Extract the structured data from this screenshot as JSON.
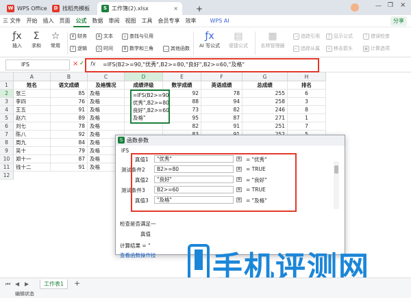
{
  "tabs": {
    "wps": "WPS Office",
    "template": "找稻壳模板",
    "file": "工作簿(2).xlsx",
    "add": "+"
  },
  "window": {
    "share": "分享"
  },
  "menus": [
    "三 文件",
    "开始",
    "插入",
    "页面",
    "公式",
    "数据",
    "审阅",
    "视图",
    "工具",
    "会员专享",
    "效率"
  ],
  "wps_ai": "WPS AI",
  "ribbon": {
    "insert_fn": "插入",
    "sum": "求和",
    "common": "常用",
    "finance": "财务",
    "logic": "逻辑",
    "text": "文本",
    "time": "时间",
    "lookup": "查找与引用",
    "math": "数学和三角",
    "other": "其他函数",
    "ai_formula": "AI 写公式",
    "convert": "便捷公式",
    "name_mgr": "名称管理器",
    "track_prec": "追踪引用",
    "track_dep": "追踪从属",
    "show_formula": "显示公式",
    "remove_arrow": "移去箭头",
    "error_check": "错误检查",
    "calc_mode": "计算工作表",
    "eval": "计算选项"
  },
  "formula_bar": {
    "name_box": "IFS",
    "fx": "fx",
    "cancel": "×",
    "confirm": "✓",
    "formula": "=IFS(B2>=90,\"优秀\",B2>=80,\"良好\",B2>=60,\"及格\""
  },
  "columns": [
    "A",
    "B",
    "C",
    "D",
    "E",
    "F",
    "G",
    "H"
  ],
  "rows": [
    "1",
    "2",
    "3",
    "4",
    "5",
    "6",
    "7",
    "8",
    "9",
    "10",
    "11",
    "12"
  ],
  "headers": [
    "姓名",
    "语文成绩",
    "及格情况",
    "成绩评级",
    "数学成绩",
    "英语成绩",
    "总成绩",
    "排名"
  ],
  "data_rows": [
    [
      "张三",
      "85",
      "及格",
      "",
      "92",
      "78",
      "255",
      "6"
    ],
    [
      "李四",
      "76",
      "及格",
      "",
      "88",
      "94",
      "258",
      "3"
    ],
    [
      "王五",
      "91",
      "及格",
      "",
      "73",
      "82",
      "246",
      "8"
    ],
    [
      "赵六",
      "89",
      "及格",
      "",
      "95",
      "87",
      "271",
      "1"
    ],
    [
      "刘七",
      "78",
      "及格",
      "",
      "82",
      "91",
      "251",
      "7"
    ],
    [
      "陈八",
      "92",
      "及格",
      "",
      "83",
      "91",
      "252",
      "5"
    ],
    [
      "周九",
      "84",
      "及格",
      "",
      "",
      "",
      "",
      ""
    ],
    [
      "吴十",
      "79",
      "及格",
      "",
      "",
      "",
      "",
      ""
    ],
    [
      "郑十一",
      "87",
      "及格",
      "",
      "",
      "",
      "",
      ""
    ],
    [
      "钱十二",
      "91",
      "及格",
      "",
      "",
      "",
      "",
      ""
    ]
  ],
  "edit_cell": "=IFS(B2>=90,\"\n优秀\",B2>=80,\"\n良好\",B2>=60,\"\n及格\"",
  "dialog": {
    "title": "函数参数",
    "fn": "IFS",
    "args": [
      {
        "label": "真值1",
        "value": "\"优秀\"",
        "result": "= \"优秀\""
      },
      {
        "label": "测试条件2",
        "value": "B2>=80",
        "result": "= TRUE"
      },
      {
        "label": "真值2",
        "value": "\"良好\"",
        "result": "= \"良好\""
      },
      {
        "label": "测试条件3",
        "value": "B2>=60",
        "result": "= TRUE"
      },
      {
        "label": "真值3",
        "value": "\"及格\"",
        "result": "= \"及格\""
      }
    ],
    "check": "检查是否满足一",
    "check_label": "真值",
    "calc_result": "计算结果 = \"",
    "help_link": "查看函数操作技"
  },
  "sheet": {
    "tab": "工作表1",
    "add": "+"
  },
  "status": {
    "mode": "编辑状态"
  },
  "watermark": "手机评测网",
  "accent": "#1a7f3c",
  "highlight": "#e3372a"
}
